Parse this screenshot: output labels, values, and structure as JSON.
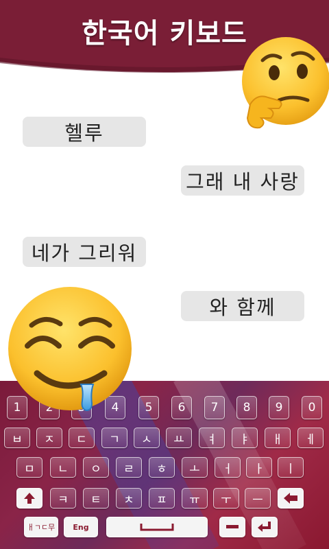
{
  "app": {
    "title": "한국어 키보드"
  },
  "colors": {
    "header": "#7a1e36",
    "bubble": "#e6e6e6",
    "keyboard": "#8a2448"
  },
  "chat": {
    "messages": [
      {
        "text": "헬루",
        "side": "left"
      },
      {
        "text": "그래 내 사랑",
        "side": "right"
      },
      {
        "text": "네가 그리워",
        "side": "left"
      },
      {
        "text": "와 함께",
        "side": "right"
      }
    ]
  },
  "emojis": [
    "thinking-face-emoji",
    "drooling-face-emoji"
  ],
  "keyboard": {
    "row1": [
      "1",
      "2",
      "3",
      "4",
      "5",
      "6",
      "7",
      "8",
      "9",
      "0"
    ],
    "row2": [
      "ㅂ",
      "ㅈ",
      "ㄷ",
      "ㄱ",
      "ㅅ",
      "ㅛ",
      "ㅕ",
      "ㅑ",
      "ㅐ",
      "ㅔ"
    ],
    "row3": [
      "ㅁ",
      "ㄴ",
      "ㅇ",
      "ㄹ",
      "ㅎ",
      "ㅗ",
      "ㅓ",
      "ㅏ",
      "ㅣ"
    ],
    "row4": [
      "ㅋ",
      "ㅌ",
      "ㅊ",
      "ㅍ",
      "ㅠ",
      "ㅜ",
      "ㅡ"
    ],
    "bottom": {
      "lang_korean": "ㅐㄱㄷ무",
      "lang_english": "Eng"
    },
    "icons": {
      "shift": "shift-icon",
      "backspace": "backspace-icon",
      "space": "space-icon",
      "minus": "minus-icon",
      "enter": "enter-icon"
    }
  }
}
